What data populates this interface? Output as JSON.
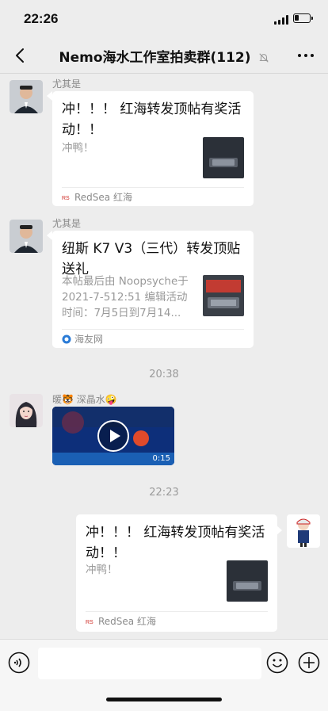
{
  "status_bar": {
    "time": "22:26"
  },
  "header": {
    "title": "Nemo海水工作室拍卖群(112)",
    "back_icon": "chevron-left-icon",
    "mute_icon": "bell-off-icon",
    "more_icon": "ellipsis-icon"
  },
  "messages": [
    {
      "sender": "尤其是",
      "card": {
        "title_line1": "冲！！！ 红海转发顶帖有奖活",
        "title_line2": "动！！",
        "desc": "冲鸭！",
        "source": "RedSea 红海"
      }
    },
    {
      "sender": "尤其是",
      "card": {
        "title_line1": "纽斯 K7 V3（三代）转发顶贴",
        "title_line2": "送礼",
        "desc_line1": "本帖最后由 Noopsyche于",
        "desc_line2": "2021-7-512:51 编辑活动",
        "desc_line3": "时间：7月5日到7月14...",
        "source": "海友网"
      }
    },
    {
      "timestamp": "20:38"
    },
    {
      "sender": "暖🐯 深晶水🤪",
      "video": {
        "duration": "0:15"
      }
    },
    {
      "timestamp": "22:23"
    },
    {
      "self": true,
      "card": {
        "title_line1": "冲！！！ 红海转发顶帖有奖活",
        "title_line2": "动！！",
        "desc": "冲鸭！",
        "source": "RedSea 红海"
      }
    }
  ],
  "input_bar": {
    "voice_icon": "voice-icon",
    "emoji_icon": "emoji-icon",
    "plus_icon": "plus-icon"
  },
  "colors": {
    "background": "#ededed",
    "card": "#ffffff",
    "muted_text": "#888888"
  }
}
